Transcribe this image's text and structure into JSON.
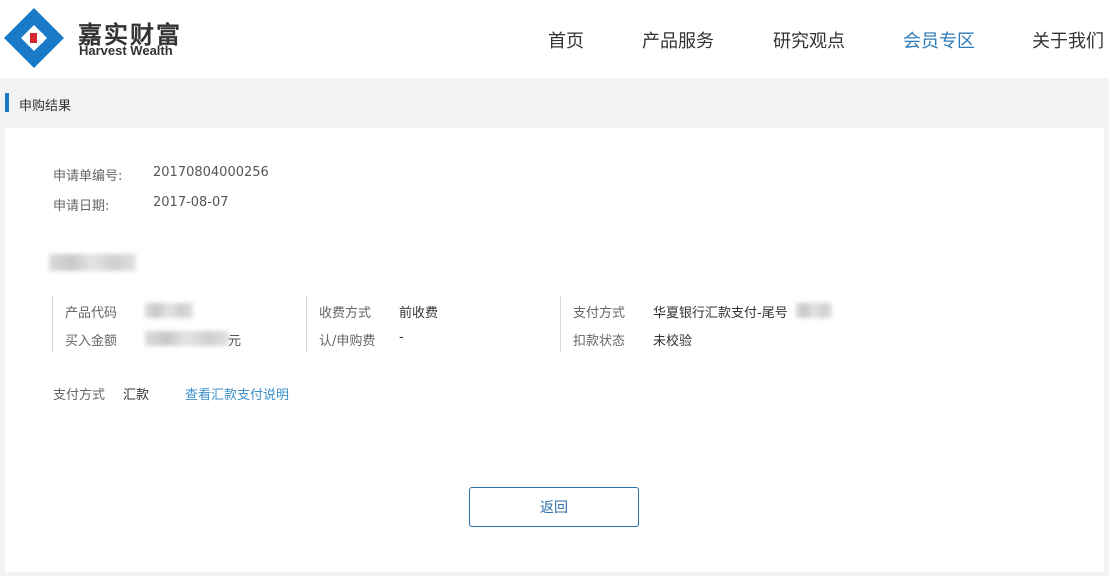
{
  "brand": {
    "name_cn": "嘉实财富",
    "name_en": "Harvest Wealth"
  },
  "nav": [
    {
      "label": "首页",
      "active": false
    },
    {
      "label": "产品服务",
      "active": false
    },
    {
      "label": "研究观点",
      "active": false
    },
    {
      "label": "会员专区",
      "active": true
    },
    {
      "label": "关于我们",
      "active": false
    }
  ],
  "breadcrumb": "申购结果",
  "application": {
    "number_label": "申请单编号:",
    "number_value": "20170804000256",
    "date_label": "申请日期:",
    "date_value": "2017-08-07"
  },
  "details": {
    "product_code_label": "产品代码",
    "amount_label": "买入金额",
    "amount_suffix": "元",
    "fee_method_label": "收费方式",
    "fee_method_value": "前收费",
    "subscription_fee_label": "认/申购费",
    "subscription_fee_value": "-",
    "payment_method_label": "支付方式",
    "payment_method_value": "华夏银行汇款支付-尾号",
    "debit_status_label": "扣款状态",
    "debit_status_value": "未校验"
  },
  "payment": {
    "label": "支付方式",
    "value": "汇款",
    "link": "查看汇款支付说明"
  },
  "back_button": "返回",
  "colors": {
    "accent": "#2d7bb8",
    "logo_blue": "#1a7ac8",
    "logo_red": "#d6262e"
  }
}
